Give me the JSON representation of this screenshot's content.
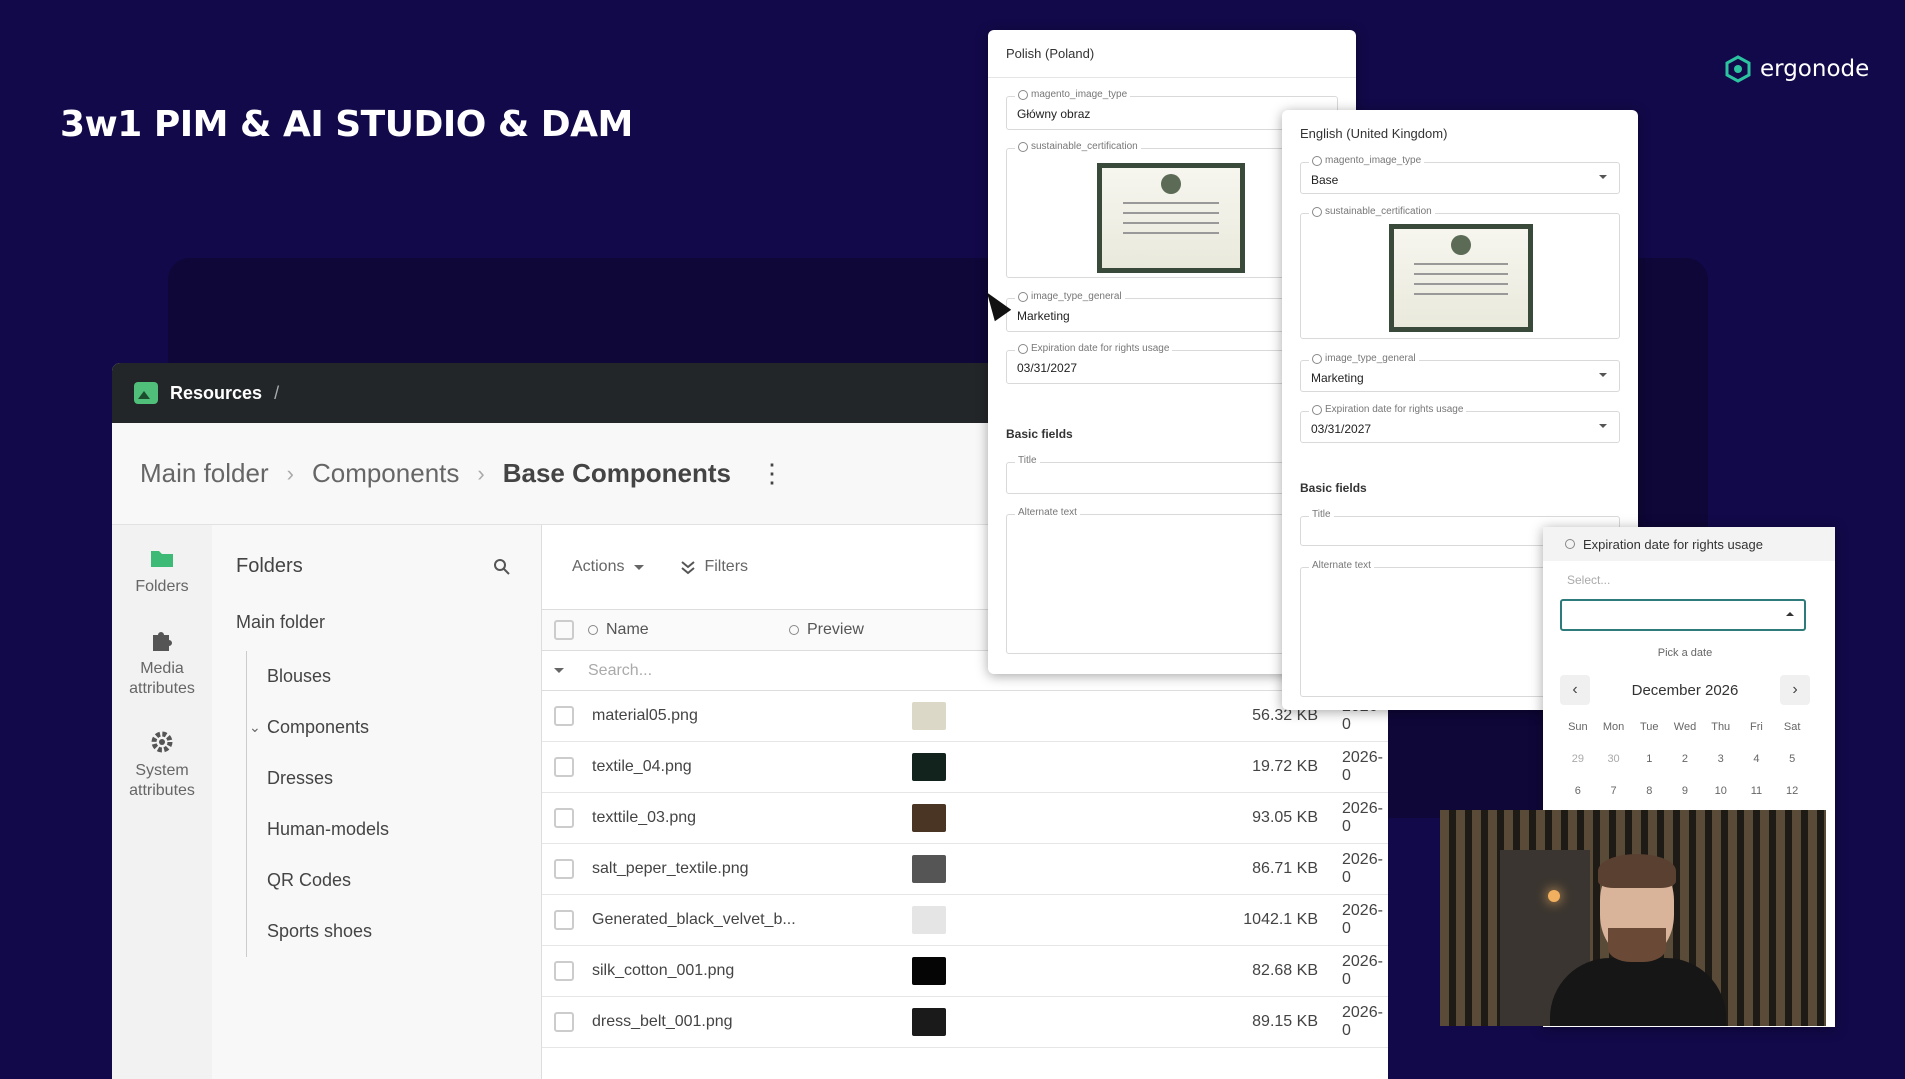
{
  "headline": "3w1 PIM & AI STUDIO & DAM",
  "brand": {
    "name": "ergonode",
    "color": "#2cc3a0"
  },
  "app": {
    "section_title": "Resources",
    "section_sep": "/",
    "breadcrumb": [
      "Main folder",
      "Components",
      "Base Components"
    ],
    "breadcrumb_sep": "›",
    "kebab": "⋮",
    "rail": [
      {
        "label": "Folders",
        "icon": "folder-icon"
      },
      {
        "label": "Media attributes",
        "icon": "puzzle-icon"
      },
      {
        "label": "System attributes",
        "icon": "gear-icon"
      }
    ],
    "folders": {
      "title": "Folders",
      "root": "Main folder",
      "items": [
        "Blouses",
        "Components",
        "Dresses",
        "Human-models",
        "QR Codes",
        "Sports shoes"
      ]
    },
    "toolbar": {
      "actions": "Actions",
      "filters": "Filters"
    },
    "table": {
      "col_name": "Name",
      "col_preview": "Preview",
      "search_placeholder": "Search...",
      "rows": [
        {
          "name": "material05.png",
          "size": "56.32",
          "unit": "KB",
          "date": "2026-0",
          "thumb": "#dcd8c8"
        },
        {
          "name": "textile_04.png",
          "size": "19.72",
          "unit": "KB",
          "date": "2026-0",
          "thumb": "#12221c"
        },
        {
          "name": "texttile_03.png",
          "size": "93.05",
          "unit": "KB",
          "date": "2026-0",
          "thumb": "#4a3424"
        },
        {
          "name": "salt_peper_textile.png",
          "size": "86.71",
          "unit": "KB",
          "date": "2026-0",
          "thumb": "#555555"
        },
        {
          "name": "Generated_black_velvet_b...",
          "size": "1042.1",
          "unit": "KB",
          "date": "2026-0",
          "thumb": "#e5e5e5"
        },
        {
          "name": "silk_cotton_001.png",
          "size": "82.68",
          "unit": "KB",
          "date": "2026-0",
          "thumb": "#050505"
        },
        {
          "name": "dress_belt_001.png",
          "size": "89.15",
          "unit": "KB",
          "date": "2026-0",
          "thumb": "#1a1a1a"
        }
      ]
    }
  },
  "panel_pl": {
    "title": "Polish (Poland)",
    "image_type_label": "magento_image_type",
    "image_type_value": "Główny obraz",
    "cert_label": "sustainable_certification",
    "general_label": "image_type_general",
    "general_value": "Marketing",
    "exp_label": "Expiration date for rights usage",
    "exp_value": "03/31/2027",
    "basic": "Basic fields",
    "title_label": "Title",
    "alt_label": "Alternate text"
  },
  "panel_en": {
    "title": "English (United Kingdom)",
    "image_type_label": "magento_image_type",
    "image_type_value": "Base",
    "cert_label": "sustainable_certification",
    "general_label": "image_type_general",
    "general_value": "Marketing",
    "exp_label": "Expiration date for rights usage",
    "exp_value": "03/31/2027",
    "basic": "Basic fields",
    "title_label": "Title",
    "alt_label": "Alternate text"
  },
  "picker": {
    "header": "Expiration date for rights usage",
    "select_placeholder": "Select...",
    "pick": "Pick a date",
    "month": "December 2026",
    "weekdays": [
      "Sun",
      "Mon",
      "Tue",
      "Wed",
      "Thu",
      "Fri",
      "Sat"
    ],
    "days": [
      "29",
      "30",
      "1",
      "2",
      "3",
      "4",
      "5",
      "6",
      "7",
      "8",
      "9",
      "10",
      "11",
      "12"
    ]
  }
}
